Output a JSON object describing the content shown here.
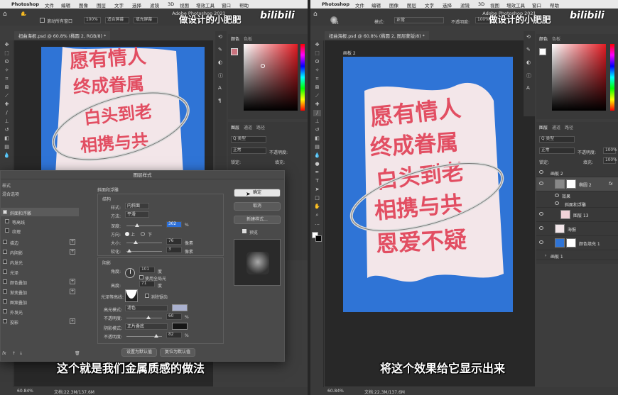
{
  "menubar_left": {
    "app": "Photoshop",
    "items": [
      "文件",
      "编辑",
      "图像",
      "图层",
      "文字",
      "选择",
      "滤镜",
      "3D",
      "视图",
      "增效工具",
      "窗口",
      "帮助"
    ]
  },
  "menubar_right": {
    "app": "Photoshop",
    "items": [
      "文件",
      "编辑",
      "图像",
      "图层",
      "文字",
      "选择",
      "滤镜",
      "3D",
      "视图",
      "增效工具",
      "窗口",
      "帮助"
    ]
  },
  "window_title": "Adobe Photoshop 2021",
  "watermark": {
    "text": "做设计的小肥肥",
    "logo": "bilibili"
  },
  "left": {
    "options": {
      "scroll_all": "滚动所有窗口",
      "zoom": "100%",
      "fit": "适合屏幕",
      "fill": "填充屏幕"
    },
    "doc_tab": "扭曲海报.psd @ 60.8% (椭圆 2, RGB/8) *",
    "status": {
      "zoom": "60.84%",
      "doc": "文档:22.3M/137.6M"
    },
    "panels": {
      "color_tabs": [
        "颜色",
        "色板"
      ],
      "layer_tabs": [
        "图层",
        "通道",
        "路径"
      ],
      "kind": "Q 类型",
      "mode": "正常",
      "opacity": "不透明度:",
      "lock": "锁定:",
      "fill": "填充:"
    },
    "caption": "这个就是我们金属质感的做法"
  },
  "right": {
    "options": {
      "brush_size": "366",
      "mode_label": "模式:",
      "mode": "正常",
      "opacity": "不透明度:",
      "opacity_val": "100%"
    },
    "doc_tab": "扭曲海报.psd @ 60.8% (椭圆 2, 图层蒙版/8) *",
    "artboard_label": "画板 2",
    "status": {
      "zoom": "60.84%",
      "doc": "文档:22.3M/137.6M"
    },
    "panels": {
      "color_tabs": [
        "颜色",
        "色板"
      ],
      "layer_tabs": [
        "图层",
        "通道",
        "路径"
      ],
      "kind": "Q 类型",
      "mode": "正常",
      "opacity": "不透明度:",
      "opacity_val": "100%",
      "lock": "锁定:",
      "fill": "填充:",
      "fill_val": "100%"
    },
    "layers": [
      {
        "name": "画板 2",
        "kind": "artboard"
      },
      {
        "name": "椭圆 2",
        "kind": "shape",
        "fx": "fx"
      },
      {
        "name": "效果",
        "kind": "effect"
      },
      {
        "name": "斜面和浮雕",
        "kind": "effect"
      },
      {
        "name": "图层 13",
        "kind": "layer"
      },
      {
        "name": "海报",
        "kind": "layer"
      },
      {
        "name": "颜色填充 1",
        "kind": "fill"
      },
      {
        "name": "画板 1",
        "kind": "artboard"
      }
    ],
    "caption": "将这个效果给它显示出来"
  },
  "poster": {
    "lines": [
      "愿有情人",
      "终成眷属",
      "白头到老",
      "相携与共",
      "恩爱不疑"
    ],
    "bg": "#2f74d6",
    "cloth": "#f3e6e9",
    "text_color": "#e24e62"
  },
  "dialog": {
    "title": "图层样式",
    "styles_header": "样式",
    "blend_options": "混合选项",
    "styles": [
      {
        "label": "斜面和浮雕",
        "checked": true,
        "selected": true
      },
      {
        "label": "等高线",
        "checked": false
      },
      {
        "label": "纹理",
        "checked": false
      },
      {
        "label": "描边",
        "checked": false,
        "plus": true
      },
      {
        "label": "内阴影",
        "checked": false,
        "plus": true
      },
      {
        "label": "内发光",
        "checked": false
      },
      {
        "label": "光泽",
        "checked": false
      },
      {
        "label": "颜色叠加",
        "checked": false,
        "plus": true
      },
      {
        "label": "渐变叠加",
        "checked": false,
        "plus": true
      },
      {
        "label": "图案叠加",
        "checked": false
      },
      {
        "label": "外发光",
        "checked": false
      },
      {
        "label": "投影",
        "checked": false,
        "plus": true
      }
    ],
    "bevel": {
      "section": "斜面和浮雕",
      "struct": "结构",
      "style_label": "样式:",
      "style_val": "内斜面",
      "method_label": "方法:",
      "method_val": "平滑",
      "depth_label": "深度:",
      "depth_val": "302",
      "depth_unit": "%",
      "dir_label": "方向:",
      "dir_up": "上",
      "dir_down": "下",
      "size_label": "大小:",
      "size_val": "76",
      "size_unit": "像素",
      "soften_label": "软化:",
      "soften_val": "3",
      "soften_unit": "像素"
    },
    "shading": {
      "section": "阴影",
      "angle_label": "角度:",
      "angle_val": "101",
      "angle_unit": "度",
      "global_light": "使用全局光",
      "altitude_label": "高度:",
      "altitude_val": "71",
      "altitude_unit": "度",
      "gloss_label": "光泽等高线:",
      "antialias": "消除锯齿",
      "hl_label": "高光模式:",
      "hl_val": "滤色",
      "hl_color": "#aab1cf",
      "hl_op_label": "不透明度:",
      "hl_op_val": "60",
      "hl_op_unit": "%",
      "sh_label": "阴影模式:",
      "sh_val": "正片叠底",
      "sh_color": "#161616",
      "sh_op_label": "不透明度:",
      "sh_op_val": "82",
      "sh_op_unit": "%"
    },
    "buttons": {
      "ok": "确定",
      "cancel": "取消",
      "new_style": "新建样式...",
      "preview": "预览",
      "set_default": "设置为默认值",
      "reset_default": "复位为默认值"
    },
    "fx_label": "fx"
  }
}
